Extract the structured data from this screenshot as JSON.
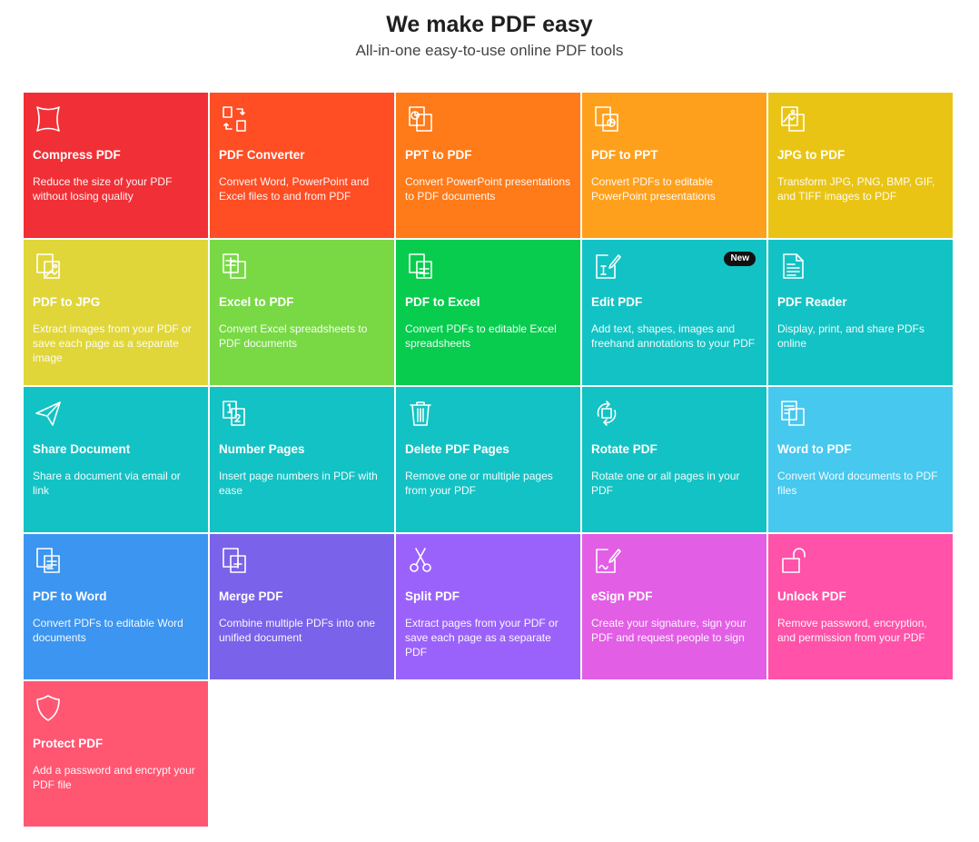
{
  "header": {
    "title": "We make PDF easy",
    "subtitle": "All-in-one easy-to-use online PDF tools"
  },
  "tools": [
    {
      "name": "Compress PDF",
      "desc": "Reduce the size of your PDF without losing quality",
      "color": "#f03036",
      "icon": "compress-icon"
    },
    {
      "name": "PDF Converter",
      "desc": "Convert Word, PowerPoint and Excel files to and from PDF",
      "color": "#ff4d24",
      "icon": "converter-icon"
    },
    {
      "name": "PPT to PDF",
      "desc": "Convert PowerPoint presentations to PDF documents",
      "color": "#ff7a18",
      "icon": "ppt-to-pdf-icon"
    },
    {
      "name": "PDF to PPT",
      "desc": "Convert PDFs to editable PowerPoint presentations",
      "color": "#ffa01c",
      "icon": "pdf-to-ppt-icon"
    },
    {
      "name": "JPG to PDF",
      "desc": "Transform JPG, PNG, BMP, GIF, and TIFF images to PDF",
      "color": "#eac414",
      "icon": "jpg-to-pdf-icon"
    },
    {
      "name": "PDF to JPG",
      "desc": "Extract images from your PDF or save each page as a separate image",
      "color": "#e0d63a",
      "icon": "pdf-to-jpg-icon"
    },
    {
      "name": "Excel to PDF",
      "desc": "Convert Excel spreadsheets to PDF documents",
      "color": "#78d944",
      "icon": "excel-to-pdf-icon"
    },
    {
      "name": "PDF to Excel",
      "desc": "Convert PDFs to editable Excel spreadsheets",
      "color": "#07cc4e",
      "icon": "pdf-to-excel-icon"
    },
    {
      "name": "Edit PDF",
      "desc": "Add text, shapes, images and freehand annotations to your PDF",
      "color": "#13c2c4",
      "icon": "edit-icon",
      "badge": "New"
    },
    {
      "name": "PDF Reader",
      "desc": "Display, print, and share PDFs online",
      "color": "#13c2c4",
      "icon": "reader-icon"
    },
    {
      "name": "Share Document",
      "desc": "Share a document via email or link",
      "color": "#13c2c4",
      "icon": "share-icon"
    },
    {
      "name": "Number Pages",
      "desc": "Insert page numbers in PDF with ease",
      "color": "#13c2c4",
      "icon": "number-pages-icon"
    },
    {
      "name": "Delete PDF Pages",
      "desc": "Remove one or multiple pages from your PDF",
      "color": "#13c2c4",
      "icon": "trash-icon"
    },
    {
      "name": "Rotate PDF",
      "desc": "Rotate one or all pages in your PDF",
      "color": "#13c2c4",
      "icon": "rotate-icon"
    },
    {
      "name": "Word to PDF",
      "desc": "Convert Word documents to PDF files",
      "color": "#46c8ef",
      "icon": "word-to-pdf-icon"
    },
    {
      "name": "PDF to Word",
      "desc": "Convert PDFs to editable Word documents",
      "color": "#3c95f0",
      "icon": "pdf-to-word-icon"
    },
    {
      "name": "Merge PDF",
      "desc": "Combine multiple PDFs into one unified document",
      "color": "#7a62ea",
      "icon": "merge-icon"
    },
    {
      "name": "Split PDF",
      "desc": "Extract pages from your PDF or save each page as a separate PDF",
      "color": "#9b62fb",
      "icon": "scissors-icon"
    },
    {
      "name": "eSign PDF",
      "desc": "Create your signature, sign your PDF and request people to sign",
      "color": "#e25ee5",
      "icon": "esign-icon"
    },
    {
      "name": "Unlock PDF",
      "desc": "Remove password, encryption, and permission from your PDF",
      "color": "#ff52a8",
      "icon": "unlock-icon"
    },
    {
      "name": "Protect PDF",
      "desc": "Add a password and encrypt your PDF file",
      "color": "#ff5672",
      "icon": "shield-icon"
    }
  ]
}
